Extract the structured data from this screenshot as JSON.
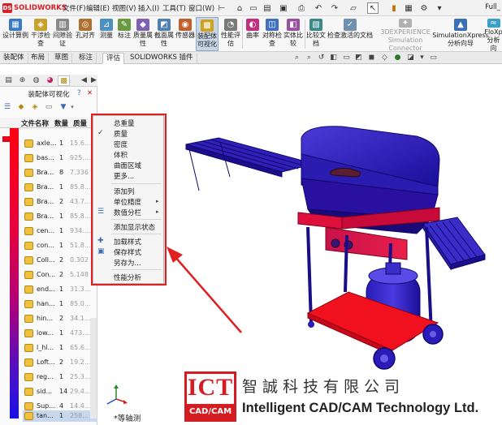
{
  "titlebar": {
    "logo_text": "SOLIDWORKS",
    "menus": [
      "文件(F)",
      "编辑(E)",
      "视图(V)",
      "插入(I)",
      "工具(T)",
      "窗口(W)"
    ],
    "filename": "Full_"
  },
  "ribbon": {
    "buttons": [
      {
        "label": "设计算例",
        "icon": "design-study-icon",
        "color": "#3a78c8"
      },
      {
        "label": "干涉检\n查",
        "icon": "interference-icon",
        "color": "#c8a030"
      },
      {
        "label": "间隙验\n证",
        "icon": "clearance-icon",
        "color": "#8a8a8a"
      },
      {
        "label": "孔对齐",
        "icon": "hole-align-icon",
        "color": "#b07030"
      },
      {
        "label": "测量",
        "icon": "measure-icon",
        "color": "#4a90c0"
      },
      {
        "label": "标注",
        "icon": "markup-icon",
        "color": "#6a9a40"
      },
      {
        "label": "质量属\n性",
        "icon": "mass-properties-icon",
        "color": "#8060b0"
      },
      {
        "label": "截面属\n性",
        "icon": "section-properties-icon",
        "color": "#5080b0"
      },
      {
        "label": "传感器",
        "icon": "sensor-icon",
        "color": "#c06030"
      },
      {
        "label": "装配体\n可视化",
        "icon": "assembly-visualization-icon",
        "color": "#d0a020"
      },
      {
        "label": "性能评\n估",
        "icon": "performance-icon",
        "color": "#7a7a7a"
      },
      {
        "label": "曲率",
        "icon": "curvature-icon",
        "color": "#c03080"
      },
      {
        "label": "对称检\n查",
        "icon": "symmetry-check-icon",
        "color": "#4070c0"
      },
      {
        "label": "实体比\n较",
        "icon": "compare-bodies-icon",
        "color": "#9a50a0"
      },
      {
        "label": "比较文\n档",
        "icon": "compare-documents-icon",
        "color": "#3a8a8a"
      },
      {
        "label": "检查激活的文档",
        "icon": "check-document-icon",
        "color": "#7090b0"
      },
      {
        "label": "3DEXPERIENCE\nSimulation Connector",
        "icon": "3dexperience-icon",
        "color": "#b0b0b0"
      },
      {
        "label": "SimulationXpress\n分析向导",
        "icon": "simulationxpress-icon",
        "color": "#3a70b8"
      },
      {
        "label": "FloXp\n分析向",
        "icon": "floxpress-icon",
        "color": "#3aa0c8"
      }
    ]
  },
  "cm_tabs": [
    "装配体",
    "布局",
    "草图",
    "标注",
    "评估",
    "SOLIDWORKS 插件"
  ],
  "cm_active_tab": "评估",
  "panel": {
    "title": "装配体可视化",
    "columns": {
      "name": "文件名称",
      "qty": "数量",
      "mass": "质量"
    },
    "rows": [
      {
        "name": "axle...",
        "qty": "1",
        "mass": "15.6..."
      },
      {
        "name": "bas...",
        "qty": "1",
        "mass": "925...."
      },
      {
        "name": "Bra...",
        "qty": "8",
        "mass": "7.336"
      },
      {
        "name": "Bra...",
        "qty": "1",
        "mass": "85.8..."
      },
      {
        "name": "Bra...",
        "qty": "2",
        "mass": "43.7..."
      },
      {
        "name": "Bra...",
        "qty": "1",
        "mass": "85.8..."
      },
      {
        "name": "cen...",
        "qty": "1",
        "mass": "934...."
      },
      {
        "name": "con...",
        "qty": "1",
        "mass": "51.8..."
      },
      {
        "name": "Coll...",
        "qty": "2",
        "mass": "0.302"
      },
      {
        "name": "Con...",
        "qty": "2",
        "mass": "5.148"
      },
      {
        "name": "end...",
        "qty": "1",
        "mass": "31.3..."
      },
      {
        "name": "han...",
        "qty": "1",
        "mass": "85.0..."
      },
      {
        "name": "hin...",
        "qty": "2",
        "mass": "34.1..."
      },
      {
        "name": "low...",
        "qty": "1",
        "mass": "473...."
      },
      {
        "name": "l_hi...",
        "qty": "1",
        "mass": "65.6..."
      },
      {
        "name": "Loft...",
        "qty": "2",
        "mass": "19.2..."
      },
      {
        "name": "reg...",
        "qty": "1",
        "mass": "25.3..."
      },
      {
        "name": "sid...",
        "qty": "14",
        "mass": "29.4..."
      },
      {
        "name": "Sup...",
        "qty": "4",
        "mass": "14.4..."
      },
      {
        "name": "tan...",
        "qty": "1",
        "mass": "258..."
      }
    ]
  },
  "context_menu": {
    "items": [
      {
        "label": "总重量",
        "icon": "",
        "submenu": false,
        "check": false
      },
      {
        "label": "质量",
        "icon": "",
        "submenu": false,
        "check": true
      },
      {
        "label": "密度",
        "icon": "",
        "submenu": false,
        "check": false
      },
      {
        "label": "体积",
        "icon": "",
        "submenu": false,
        "check": false
      },
      {
        "label": "曲面区域",
        "icon": "",
        "submenu": false,
        "check": false
      },
      {
        "label": "更多...",
        "icon": "",
        "submenu": false,
        "check": false
      },
      {
        "label": "添加列",
        "icon": "",
        "submenu": false,
        "check": false
      },
      {
        "label": "单位精度",
        "icon": "",
        "submenu": true,
        "check": false
      },
      {
        "label": "数值分栏",
        "icon": "value-bars-icon",
        "submenu": true,
        "check": false
      },
      {
        "label": "添加显示状态",
        "icon": "",
        "submenu": false,
        "check": false
      },
      {
        "label": "加载样式",
        "icon": "load-style-icon",
        "submenu": false,
        "check": false
      },
      {
        "label": "保存样式",
        "icon": "save-style-icon",
        "submenu": false,
        "check": false
      },
      {
        "label": "另存为...",
        "icon": "",
        "submenu": false,
        "check": false
      },
      {
        "label": "性能分析",
        "icon": "",
        "submenu": false,
        "check": false
      }
    ]
  },
  "watermark": {
    "big": "ICT",
    "sub": "CAD/CAM",
    "cn": "智誠科技有限公司",
    "en": "Intelligent CAD/CAM Technology Ltd."
  },
  "viewport": {
    "view_label": "*等轴测"
  },
  "colors": {
    "accent_red": "#e02020",
    "heat_high": "#ff0011",
    "heat_low": "#1a10e8"
  }
}
